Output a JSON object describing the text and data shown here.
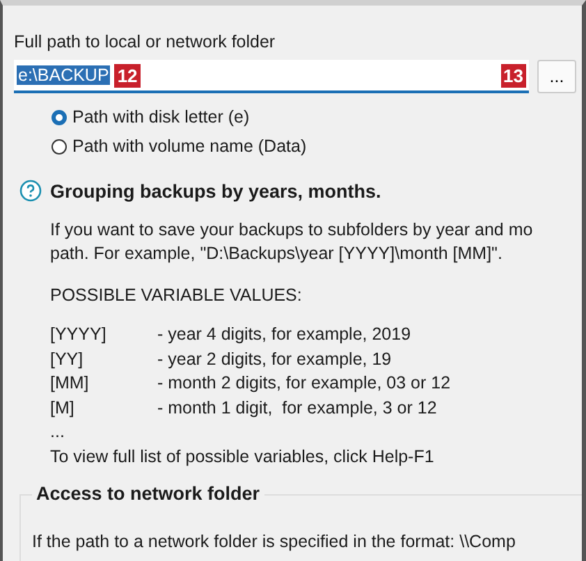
{
  "path_field": {
    "label": "Full path to local or network folder",
    "value": "e:\\BACKUP",
    "text_selected": true,
    "badge": "12"
  },
  "browse": {
    "label": "...",
    "badge": "13"
  },
  "path_options": [
    {
      "label": "Path with disk letter (e)",
      "selected": true
    },
    {
      "label": "Path with volume name (Data)",
      "selected": false
    }
  ],
  "grouping": {
    "title": "Grouping backups by years, months.",
    "text": "If you want to save your backups to subfolders by year and mo",
    "text2": "path. For example, \"D:\\Backups\\year [YYYY]\\month [MM]\".",
    "variables_heading": "POSSIBLE VARIABLE VALUES:",
    "variables": [
      {
        "name": "[YYYY]",
        "description": "- year 4 digits, for example, 2019"
      },
      {
        "name": "[YY]",
        "description": "- year 2 digits, for example, 19"
      },
      {
        "name": "[MM]",
        "description": "- month 2 digits, for example, 03 or 12"
      },
      {
        "name": "[M]",
        "description": "- month 1 digit,  for example, 3 or 12"
      }
    ],
    "ellipsis": "...",
    "footer": "To view full list of possible variables, click Help-F1"
  },
  "network": {
    "title": "Access to network folder",
    "text": "If the path to a network folder is specified in the format: \\\\Comp"
  }
}
